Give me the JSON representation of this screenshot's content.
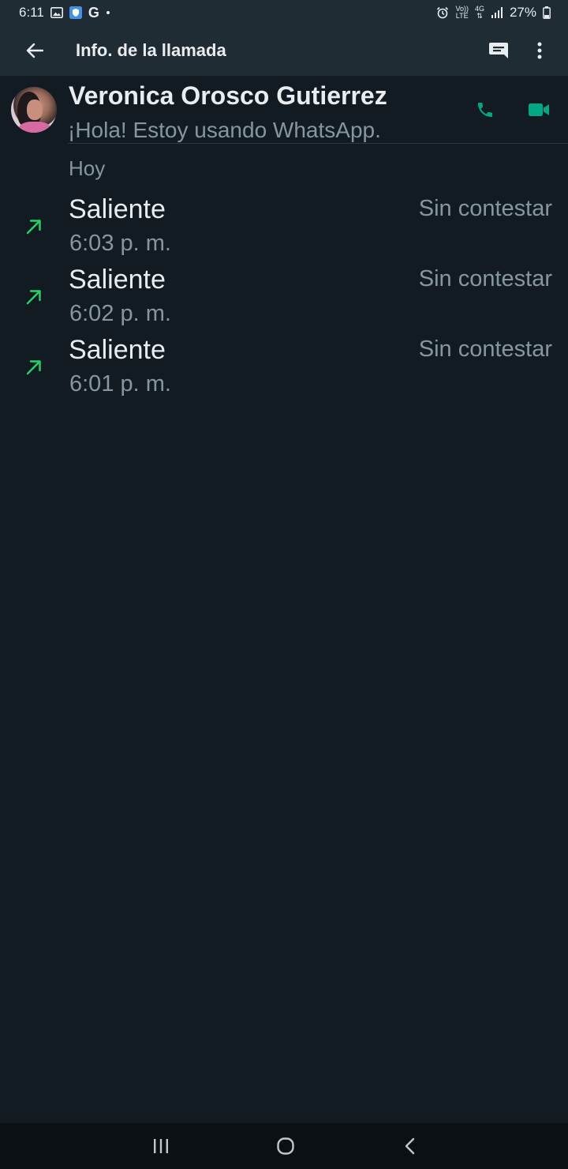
{
  "status_bar": {
    "time": "6:11",
    "left_icons": [
      "gallery-icon",
      "shield-icon",
      "google-icon",
      "dot-icon"
    ],
    "google_letter": "G",
    "right_icons": [
      "alarm-icon",
      "volte-icon",
      "4g-icon",
      "signal-icon",
      "battery-icon"
    ],
    "volte_top": "Vo))",
    "volte_bottom": "LTE",
    "net_label": "4G",
    "battery": "27%"
  },
  "app_bar": {
    "title": "Info. de la llamada",
    "icons": [
      "back-arrow-icon",
      "message-icon",
      "more-vert-icon"
    ]
  },
  "contact": {
    "name": "Veronica Orosco Gutierrez",
    "status": "¡Hola! Estoy usando WhatsApp.",
    "icons": [
      "phone-icon",
      "video-icon"
    ]
  },
  "calls": {
    "section": "Hoy",
    "items": [
      {
        "type": "Saliente",
        "time": "6:03 p. m.",
        "result": "Sin contestar"
      },
      {
        "type": "Saliente",
        "time": "6:02 p. m.",
        "result": "Sin contestar"
      },
      {
        "type": "Saliente",
        "time": "6:01 p. m.",
        "result": "Sin contestar"
      }
    ]
  },
  "colors": {
    "background": "#121b22",
    "bar": "#1f2c34",
    "accent": "#00a884",
    "outgoing_arrow": "#25d366",
    "secondary_text": "#8696a0",
    "primary_text": "#e9edef"
  },
  "nav_bar": {
    "icons": [
      "recents-icon",
      "home-icon",
      "back-icon"
    ]
  }
}
